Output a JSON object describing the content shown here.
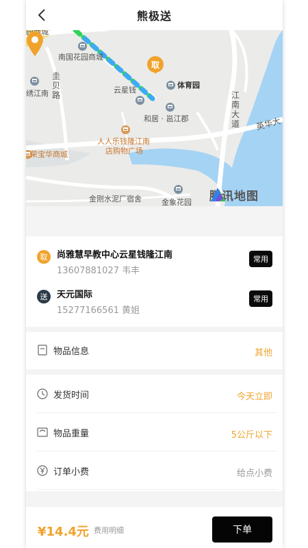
{
  "header": {
    "title": "熊极送"
  },
  "map": {
    "labels": {
      "huayuan": "南国花园商城",
      "guibeilu": "圭贝路",
      "xiujiangnan": "绣江南",
      "yunxing": "云星钱",
      "tiyuyuan": "体育园",
      "heju": "和居 · 邕江郡",
      "jiangnandadao": "江南大道",
      "yinghua": "英华大",
      "renrenle": "人人乐钱隆江南",
      "dianmall": "店购物广场",
      "rongbaohua": "荣宝华商城",
      "jingang": "金刚水泥厂宿舍",
      "jinxiang": "金象花园",
      "topcut": "园商城"
    },
    "pick_marker": "取",
    "provider": "腾讯地图",
    "colors": {
      "route": "#3fa9f5",
      "route_alt": "#2fd35a",
      "pin": "#f0a32c",
      "water": "#a5d3f4"
    }
  },
  "addresses": {
    "pickup": {
      "badge": "取",
      "name": "尚雅慧早教中心云星钱隆江南",
      "contact": "13607881027 韦丰",
      "tag": "常用",
      "badge_color": "#f0a32c"
    },
    "delivery": {
      "badge": "送",
      "name": "天元国际",
      "contact": "15277166561 黄姐",
      "tag": "常用",
      "badge_color": "#2b3a47"
    }
  },
  "item_info": {
    "label": "物品信息",
    "value": "其他"
  },
  "details": {
    "ship_time": {
      "label": "发货时间",
      "value": "今天立即"
    },
    "weight": {
      "label": "物品重量",
      "value": "5公斤以下"
    },
    "tip": {
      "label": "订单小费",
      "value": "给点小费"
    }
  },
  "footer": {
    "price": "¥14.4元",
    "fee_detail": "费用明细",
    "order_button": "下单"
  }
}
